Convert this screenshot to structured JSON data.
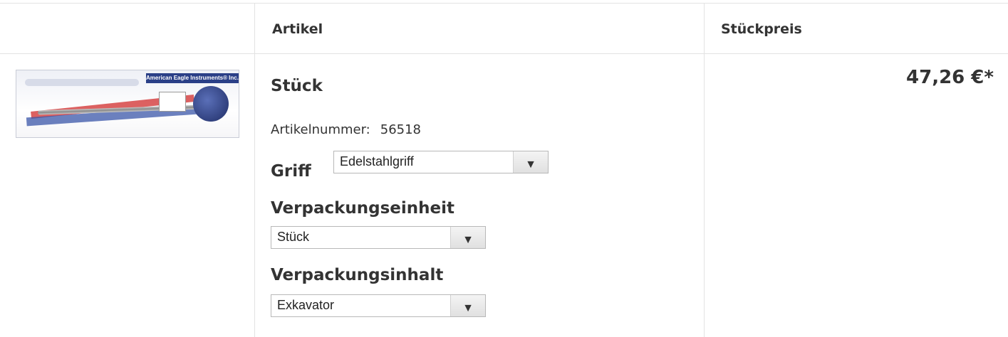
{
  "header": {
    "col_article": "Artikel",
    "col_unit_price": "Stückpreis"
  },
  "product": {
    "image_alt": "American Eagle Instruments Inc. Exkavator in Verpackung",
    "image_banner_text": "American Eagle Instruments® Inc.",
    "title": "Stück",
    "article_number_label": "Artikelnummer:",
    "article_number": "56518",
    "options": {
      "griff": {
        "label": "Griff",
        "selected": "Edelstahlgriff"
      },
      "verpackungseinheit": {
        "label": "Verpackungseinheit",
        "selected": "Stück"
      },
      "verpackungsinhalt": {
        "label": "Verpackungsinhalt",
        "selected": "Exkavator"
      }
    },
    "price": "47,26 €*"
  },
  "icons": {
    "dropdown": "chevron-down-icon"
  },
  "colors": {
    "border": "#e3e3e3",
    "text": "#333333"
  }
}
